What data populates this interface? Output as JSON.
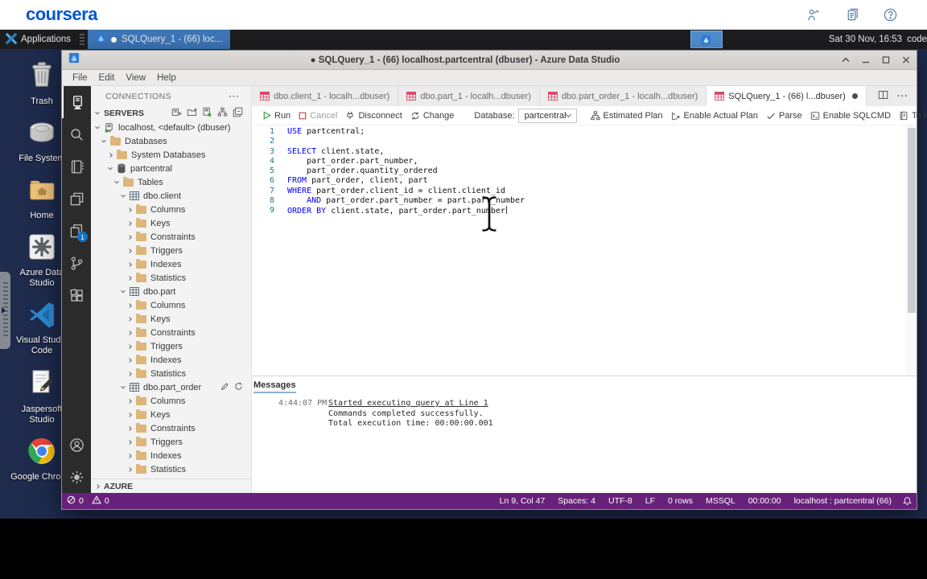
{
  "colors": {
    "coursera_blue": "#0056D2",
    "desktop_navy": "#1E2B4D",
    "taskbar_highlight": "#3E76B8",
    "status_purple": "#68217A",
    "keyword_blue": "#0000FF",
    "folder_tan": "#DCB67A",
    "tab_icon_pink": "#D9486B",
    "badge_blue": "#1273C4",
    "run_green": "#4AA14A",
    "cancel_red": "#CF4444"
  },
  "top_bar": {
    "logo": "coursera"
  },
  "taskbar": {
    "applications": "Applications",
    "window_button": "SQLQuery_1 - (66) loc...",
    "clock": "Sat 30 Nov, 16:53",
    "session": "code"
  },
  "desktop_icons": [
    {
      "label": "Trash",
      "icon": "trash"
    },
    {
      "label": "File System",
      "icon": "filesystem"
    },
    {
      "label": "Home",
      "icon": "home"
    },
    {
      "label": "Azure Data Studio",
      "icon": "ads"
    },
    {
      "label": "Visual Studio Code",
      "icon": "vscode"
    },
    {
      "label": "Jaspersoft Studio",
      "icon": "jaspersoft"
    },
    {
      "label": "Google Chrome",
      "icon": "chrome"
    }
  ],
  "window": {
    "dirty_dot": "●",
    "title": "SQLQuery_1 - (66) localhost.partcentral (dbuser) - Azure Data Studio",
    "menus": [
      "File",
      "Edit",
      "View",
      "Help"
    ],
    "activity_badge": "1",
    "sidebar": {
      "connections_header": "CONNECTIONS",
      "connections_more": "···",
      "servers_header": "SERVERS",
      "azure_header": "AZURE",
      "tree": [
        {
          "label": "localhost, <default> (dbuser)",
          "lvl": 0,
          "chev": "v",
          "icon": "server"
        },
        {
          "label": "Databases",
          "lvl": 1,
          "chev": "v",
          "icon": "folder"
        },
        {
          "label": "System Databases",
          "lvl": 2,
          "chev": ">",
          "icon": "folder"
        },
        {
          "label": "partcentral",
          "lvl": 2,
          "chev": "v",
          "icon": "database"
        },
        {
          "label": "Tables",
          "lvl": 3,
          "chev": "v",
          "icon": "folder"
        },
        {
          "label": "dbo.client",
          "lvl": 4,
          "chev": "v",
          "icon": "table"
        },
        {
          "label": "Columns",
          "lvl": 5,
          "chev": ">",
          "icon": "folder"
        },
        {
          "label": "Keys",
          "lvl": 5,
          "chev": ">",
          "icon": "folder"
        },
        {
          "label": "Constraints",
          "lvl": 5,
          "chev": ">",
          "icon": "folder"
        },
        {
          "label": "Triggers",
          "lvl": 5,
          "chev": ">",
          "icon": "folder"
        },
        {
          "label": "Indexes",
          "lvl": 5,
          "chev": ">",
          "icon": "folder"
        },
        {
          "label": "Statistics",
          "lvl": 5,
          "chev": ">",
          "icon": "folder"
        },
        {
          "label": "dbo.part",
          "lvl": 4,
          "chev": "v",
          "icon": "table"
        },
        {
          "label": "Columns",
          "lvl": 5,
          "chev": ">",
          "icon": "folder"
        },
        {
          "label": "Keys",
          "lvl": 5,
          "chev": ">",
          "icon": "folder"
        },
        {
          "label": "Constraints",
          "lvl": 5,
          "chev": ">",
          "icon": "folder"
        },
        {
          "label": "Triggers",
          "lvl": 5,
          "chev": ">",
          "icon": "folder"
        },
        {
          "label": "Indexes",
          "lvl": 5,
          "chev": ">",
          "icon": "folder"
        },
        {
          "label": "Statistics",
          "lvl": 5,
          "chev": ">",
          "icon": "folder"
        },
        {
          "label": "dbo.part_order",
          "lvl": 4,
          "chev": "v",
          "icon": "table",
          "actions": true
        },
        {
          "label": "Columns",
          "lvl": 5,
          "chev": ">",
          "icon": "folder"
        },
        {
          "label": "Keys",
          "lvl": 5,
          "chev": ">",
          "icon": "folder"
        },
        {
          "label": "Constraints",
          "lvl": 5,
          "chev": ">",
          "icon": "folder"
        },
        {
          "label": "Triggers",
          "lvl": 5,
          "chev": ">",
          "icon": "folder"
        },
        {
          "label": "Indexes",
          "lvl": 5,
          "chev": ">",
          "icon": "folder"
        },
        {
          "label": "Statistics",
          "lvl": 5,
          "chev": ">",
          "icon": "folder"
        }
      ]
    },
    "tabs": [
      {
        "label": "dbo.client_1 - localh...dbuser)",
        "active": false,
        "dirty": false
      },
      {
        "label": "dbo.part_1 - localh...dbuser)",
        "active": false,
        "dirty": false
      },
      {
        "label": "dbo.part_order_1 - localh...dbuser)",
        "active": false,
        "dirty": false
      },
      {
        "label": "SQLQuery_1 - (66) l...dbuser)",
        "active": true,
        "dirty": true
      }
    ],
    "tabs_more": "···",
    "toolbar": {
      "run": "Run",
      "cancel": "Cancel",
      "disconnect": "Disconnect",
      "change": "Change",
      "database_label": "Database:",
      "database_value": "partcentral",
      "estimated_plan": "Estimated Plan",
      "actual_plan": "Enable Actual Plan",
      "parse": "Parse",
      "sqlcmd": "Enable SQLCMD",
      "notebook": "To Notebook"
    },
    "editor": {
      "lines": [
        {
          "n": "1",
          "segs": [
            {
              "t": "USE",
              "k": 1
            },
            {
              "t": " partcentral;"
            }
          ]
        },
        {
          "n": "2",
          "segs": []
        },
        {
          "n": "3",
          "segs": [
            {
              "t": "SELECT",
              "k": 1
            },
            {
              "t": " client.state,"
            }
          ]
        },
        {
          "n": "4",
          "segs": [
            {
              "t": "    part_order.part_number,"
            }
          ]
        },
        {
          "n": "5",
          "segs": [
            {
              "t": "    part_order.quantity_ordered"
            }
          ]
        },
        {
          "n": "6",
          "segs": [
            {
              "t": "FROM",
              "k": 1
            },
            {
              "t": " part_order, client, part"
            }
          ]
        },
        {
          "n": "7",
          "segs": [
            {
              "t": "WHERE",
              "k": 1
            },
            {
              "t": " part_order.client_id = client.client_id"
            }
          ]
        },
        {
          "n": "8",
          "segs": [
            {
              "t": "    "
            },
            {
              "t": "AND",
              "k": 1
            },
            {
              "t": " part_order.part_number = part.part_number"
            }
          ]
        },
        {
          "n": "9",
          "segs": [
            {
              "t": "ORDER BY",
              "k": 1
            },
            {
              "t": " client.state, part_order.part_number"
            }
          ],
          "caret": true
        }
      ]
    },
    "messages": {
      "header": "Messages",
      "timestamp": "4:44:07 PM",
      "link": "Started executing query at Line 1",
      "lines": [
        "Commands completed successfully.",
        "Total execution time: 00:00:00.001"
      ]
    },
    "status": {
      "errors": "0",
      "warnings": "0",
      "items": [
        "Ln 9, Col 47",
        "Spaces: 4",
        "UTF-8",
        "LF",
        "0 rows",
        "MSSQL",
        "00:00:00",
        "localhost : partcentral (66)"
      ]
    }
  }
}
